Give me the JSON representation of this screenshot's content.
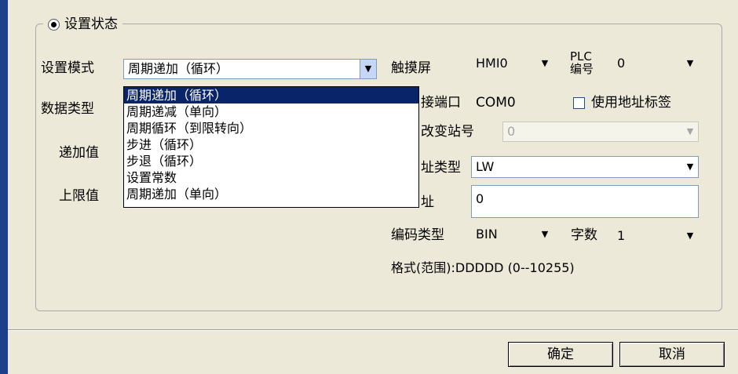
{
  "group": {
    "radio_label": "设置状态"
  },
  "mode": {
    "label": "设置模式",
    "selected": "周期递加（循环）",
    "options": [
      "周期递加（循环）",
      "周期递减（单向）",
      "周期循环（到限转向）",
      "步进（循环）",
      "步退（循环）",
      "设置常数",
      "周期递加（单向）"
    ]
  },
  "data_type": {
    "label": "数据类型"
  },
  "increment": {
    "label": "递加值"
  },
  "upper_limit": {
    "label": "上限值"
  },
  "touchscreen": {
    "label": "触摸屏",
    "value": "HMI0"
  },
  "plc_no": {
    "label_line1": "PLC",
    "label_line2": "编号",
    "value": "0"
  },
  "port": {
    "label_visible": "接端口",
    "value": "COM0"
  },
  "address_tag": {
    "label": "使用地址标签",
    "checked": false
  },
  "station": {
    "label_visible": "改变站号",
    "value": "0"
  },
  "addr_type": {
    "label_visible": "址类型",
    "value": "LW"
  },
  "address": {
    "label_visible": "址",
    "value": "0"
  },
  "encoding": {
    "label": "编码类型",
    "value": "BIN"
  },
  "word_count": {
    "label": "字数",
    "value": "1"
  },
  "format_info": "格式(范围):DDDDD (0--10255)",
  "buttons": {
    "ok": "确定",
    "cancel": "取消"
  }
}
